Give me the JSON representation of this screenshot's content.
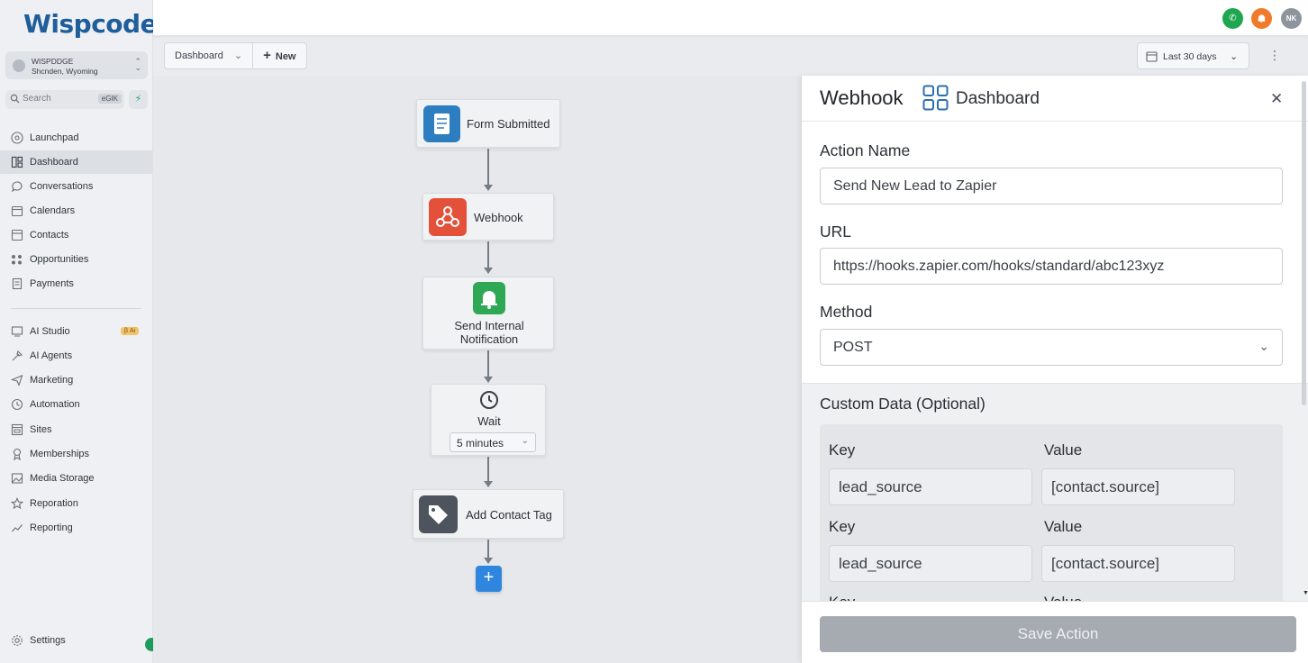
{
  "app": {
    "logo_text": "Wispcode"
  },
  "account": {
    "name": "WISPDDGE",
    "location": "Shcnden, Wyoming"
  },
  "search": {
    "placeholder": "Search",
    "shortcut": "eGIK"
  },
  "sidebar": {
    "items": [
      {
        "label": "Launchpad",
        "icon": "launchpad-icon"
      },
      {
        "label": "Dashboard",
        "icon": "dashboard-icon",
        "active": true
      },
      {
        "label": "Conversations",
        "icon": "chat-icon"
      },
      {
        "label": "Calendars",
        "icon": "calendar-icon"
      },
      {
        "label": "Contacts",
        "icon": "contacts-icon"
      },
      {
        "label": "Opportunities",
        "icon": "opportunities-icon"
      },
      {
        "label": "Payments",
        "icon": "payments-icon"
      }
    ],
    "items2": [
      {
        "label": "AI Studio",
        "icon": "ai-studio-icon",
        "badge": "β Ai"
      },
      {
        "label": "AI Agents",
        "icon": "ai-agents-icon"
      },
      {
        "label": "Marketing",
        "icon": "marketing-icon"
      },
      {
        "label": "Automation",
        "icon": "automation-icon"
      },
      {
        "label": "Sites",
        "icon": "sites-icon"
      },
      {
        "label": "Memberships",
        "icon": "memberships-icon"
      },
      {
        "label": "Media Storage",
        "icon": "media-storage-icon"
      },
      {
        "label": "Reporation",
        "icon": "star-icon"
      },
      {
        "label": "Reporting",
        "icon": "reporting-icon"
      }
    ],
    "settings_label": "Settings"
  },
  "topbar": {
    "avatar_initials": "NK",
    "colors": {
      "phone": "#1fa64f",
      "notify": "#ef7a2a",
      "avatar": "#8e949c"
    }
  },
  "toolbar": {
    "dashboard_label": "Dashboard",
    "new_label": "New",
    "date_range": "Last 30 days"
  },
  "workflow": {
    "nodes": {
      "trigger": "Form Submitted",
      "webhook": "Webhook",
      "notify_line1": "Send Internal",
      "notify_line2": "Notification",
      "wait": "Wait",
      "wait_value": "5 minutes",
      "tag": "Add Contact Tag"
    },
    "add_label": "+"
  },
  "panel": {
    "title": "Webhook",
    "subtitle": "Dashboard",
    "action_name_label": "Action Name",
    "action_name_value": "Send New Lead to Zapier",
    "url_label": "URL",
    "url_value": "https://hooks.zapier.com/hooks/standard/abc123xyz",
    "method_label": "Method",
    "method_value": "POST",
    "custom_data_label": "Custom Data (Optional)",
    "key_label": "Key",
    "value_label": "Value",
    "key_partial": "Key",
    "value_partial": "Value",
    "rows": [
      {
        "key": "lead_source",
        "value": "[contact.source]"
      },
      {
        "key": "lead_source",
        "value": "[contact.source]"
      }
    ],
    "save_label": "Save Action"
  }
}
